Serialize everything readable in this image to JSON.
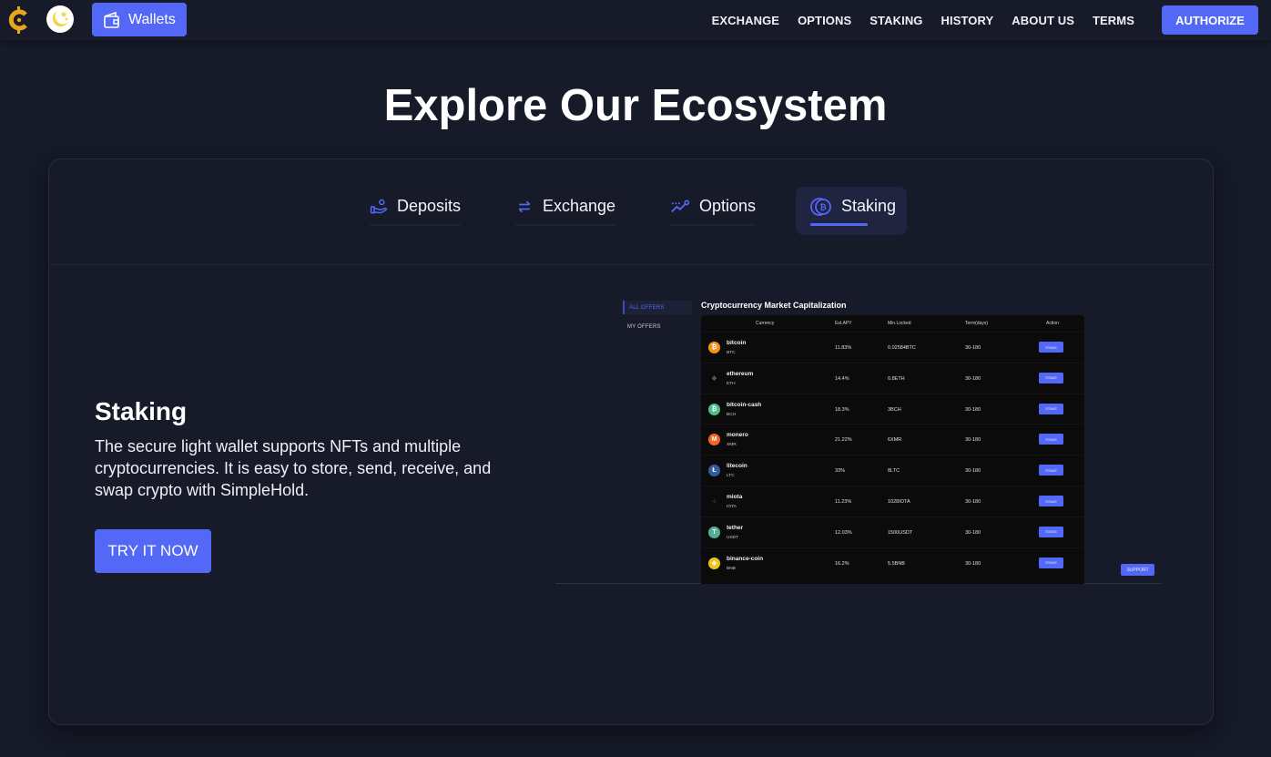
{
  "header": {
    "logo_icon": "coin-c-logo-icon",
    "theme_icon": "moon-stars-icon",
    "wallets_label": "Wallets",
    "nav": [
      "EXCHANGE",
      "OPTIONS",
      "STAKING",
      "HISTORY",
      "ABOUT US",
      "TERMS"
    ],
    "authorize_label": "AUTHORIZE"
  },
  "colors": {
    "accent": "#5468f8",
    "background": "#161a29",
    "card": "#171a29",
    "logo": "#e9a717"
  },
  "page_title": "Explore Our Ecosystem",
  "tabs": [
    {
      "label": "Deposits",
      "icon": "hand-coin-icon",
      "active": false
    },
    {
      "label": "Exchange",
      "icon": "swap-arrows-icon",
      "active": false
    },
    {
      "label": "Options",
      "icon": "trend-chart-icon",
      "active": false
    },
    {
      "label": "Staking",
      "icon": "bitcoin-coins-icon",
      "active": true,
      "progress": 0.7
    }
  ],
  "feature": {
    "title": "Staking",
    "description": "The secure light wallet supports NFTs and multiple cryptocurrencies. It is easy to store, send, receive, and swap crypto with SimpleHold.",
    "cta_label": "TRY IT NOW"
  },
  "preview": {
    "sidebar": [
      "ALL OFFERS",
      "MY OFFERS"
    ],
    "title": "Cryptocurrency Market Capitalization",
    "columns": [
      "Currency",
      "Est.APY",
      "Min.Locked",
      "Term(days)",
      "Action"
    ],
    "rows": [
      {
        "name": "bitcoin",
        "symbol": "BTC",
        "apy": "11.83%",
        "min_locked": "0.02584BTC",
        "term": "30-180",
        "action": "STAKE",
        "icon_color": "#f7931a",
        "glyph": "₿"
      },
      {
        "name": "ethereum",
        "symbol": "ETH",
        "apy": "14.4%",
        "min_locked": "0.8ETH",
        "term": "30-180",
        "action": "STAKE",
        "icon_color": "#0b0b0c",
        "glyph": "◆"
      },
      {
        "name": "bitcoin-cash",
        "symbol": "BCH",
        "apy": "18.3%",
        "min_locked": "3BCH",
        "term": "30-180",
        "action": "STAKE",
        "icon_color": "#4cc088",
        "glyph": "₿"
      },
      {
        "name": "monero",
        "symbol": "XMR",
        "apy": "21.22%",
        "min_locked": "6XMR",
        "term": "30-180",
        "action": "STAKE",
        "icon_color": "#f26822",
        "glyph": "M"
      },
      {
        "name": "litecoin",
        "symbol": "LTC",
        "apy": "33%",
        "min_locked": "8LTC",
        "term": "30-180",
        "action": "STAKE",
        "icon_color": "#345d9d",
        "glyph": "Ł"
      },
      {
        "name": "miota",
        "symbol": "IOTA",
        "apy": "11.23%",
        "min_locked": "1028IOTA",
        "term": "30-180",
        "action": "STAKE",
        "icon_color": "#0b0b0c",
        "glyph": "⁘"
      },
      {
        "name": "tether",
        "symbol": "USDT",
        "apy": "12.03%",
        "min_locked": "1500USDT",
        "term": "30-180",
        "action": "STAKE",
        "icon_color": "#50af95",
        "glyph": "T"
      },
      {
        "name": "binance-coin",
        "symbol": "BNB",
        "apy": "16.2%",
        "min_locked": "5.5BNB",
        "term": "30-180",
        "action": "STAKE",
        "icon_color": "#f0c419",
        "glyph": "◈"
      }
    ],
    "support_label": "SUPPORT"
  }
}
